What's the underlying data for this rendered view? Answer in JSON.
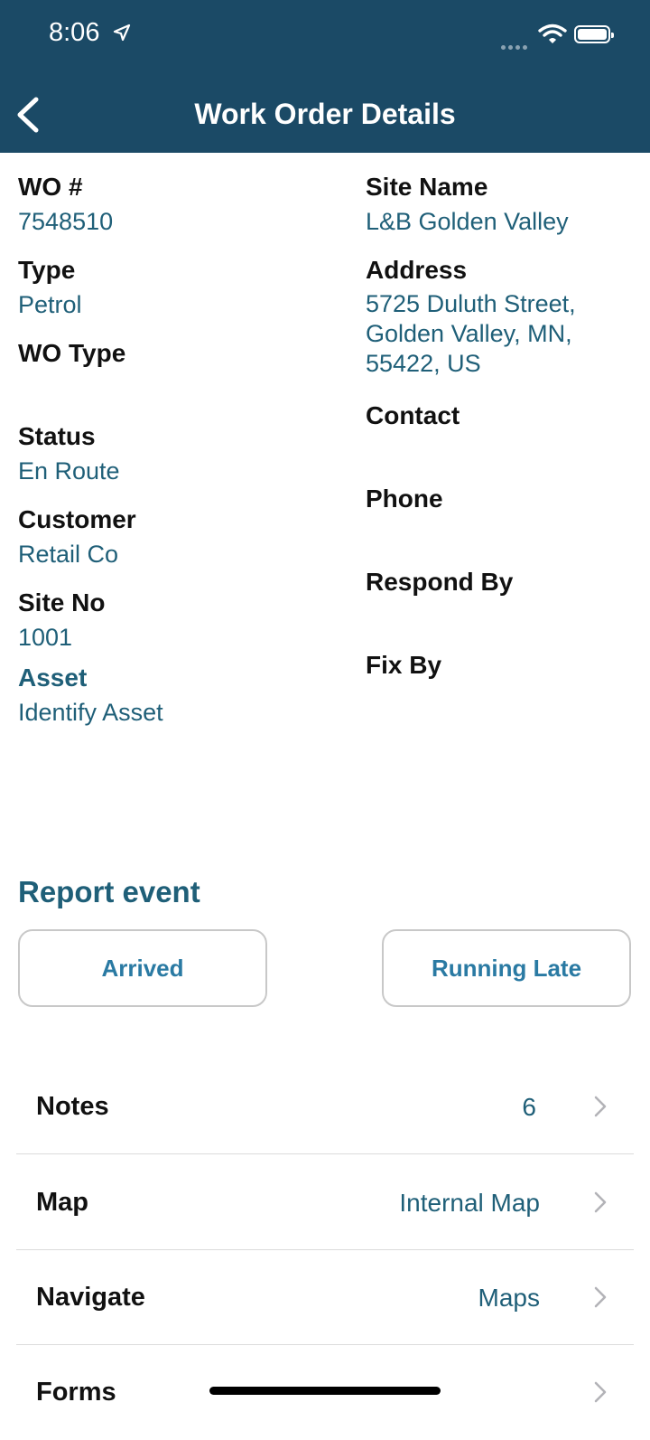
{
  "status_bar": {
    "time": "8:06"
  },
  "header": {
    "title": "Work Order Details"
  },
  "left_fields": [
    {
      "label": "WO #",
      "value": "7548510"
    },
    {
      "label": "Type",
      "value": "Petrol"
    },
    {
      "label": "WO Type",
      "value": ""
    },
    {
      "label": "Status",
      "value": "En Route"
    },
    {
      "label": "Customer",
      "value": "Retail Co"
    },
    {
      "label": "Site No",
      "value": "1001"
    },
    {
      "label": "Asset",
      "value": "Identify Asset"
    }
  ],
  "right_fields": [
    {
      "label": "Site Name",
      "value": "L&B Golden Valley"
    },
    {
      "label": "Address",
      "value_lines": [
        "5725 Duluth Street,",
        "Golden Valley, MN,",
        "55422, US"
      ]
    },
    {
      "label": "Contact",
      "value": ""
    },
    {
      "label": "Phone",
      "value": ""
    },
    {
      "label": "Respond By",
      "value": ""
    },
    {
      "label": "Fix By",
      "value": ""
    }
  ],
  "report_event": {
    "title": "Report event",
    "buttons": {
      "arrived": "Arrived",
      "running_late": "Running Late"
    }
  },
  "rows": [
    {
      "label": "Notes",
      "value": "6"
    },
    {
      "label": "Map",
      "value": "Internal Map"
    },
    {
      "label": "Navigate",
      "value": "Maps"
    },
    {
      "label": "Forms",
      "value": ""
    }
  ],
  "colors": {
    "header_bg": "#1b4a66",
    "value_text": "#1f5f78",
    "button_text": "#2a7aa3"
  }
}
